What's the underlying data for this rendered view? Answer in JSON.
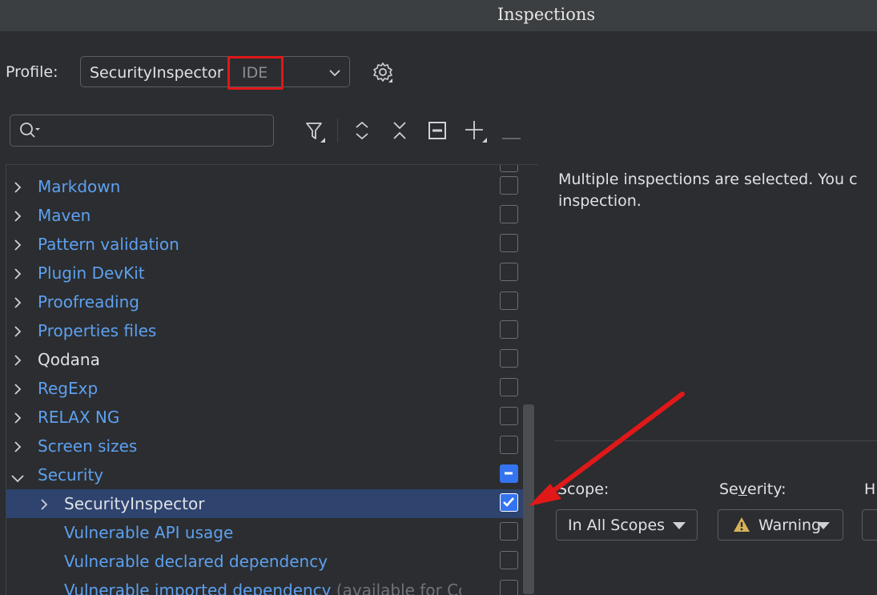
{
  "window": {
    "title": "Inspections"
  },
  "profile": {
    "label": "Profile:",
    "name": "SecurityInspector",
    "scope": "IDE"
  },
  "search": {
    "placeholder": ""
  },
  "tree": {
    "rows": [
      {
        "label": "Markdown",
        "expanded": false,
        "checked": false
      },
      {
        "label": "Maven",
        "expanded": false,
        "checked": false
      },
      {
        "label": "Pattern validation",
        "expanded": false,
        "checked": false
      },
      {
        "label": "Plugin DevKit",
        "expanded": false,
        "checked": false
      },
      {
        "label": "Proofreading",
        "expanded": false,
        "checked": false
      },
      {
        "label": "Properties files",
        "expanded": false,
        "checked": false
      },
      {
        "label": "Qodana",
        "expanded": false,
        "checked": false
      },
      {
        "label": "RegExp",
        "expanded": false,
        "checked": false
      },
      {
        "label": "RELAX NG",
        "expanded": false,
        "checked": false
      },
      {
        "label": "Screen sizes",
        "expanded": false,
        "checked": false
      },
      {
        "label": "Security",
        "expanded": true,
        "checked": "partial"
      },
      {
        "label": "SecurityInspector",
        "expanded": false,
        "checked": true,
        "selected": true
      },
      {
        "label": "Vulnerable API usage",
        "checked": false
      },
      {
        "label": "Vulnerable declared dependency",
        "checked": false
      },
      {
        "label": "Vulnerable imported dependency",
        "suffix": "(available for Cc",
        "checked": false
      }
    ]
  },
  "details": {
    "description_line1": "Multiple inspections are selected. You c",
    "description_line2": "inspection.",
    "scope_label": "Scope:",
    "severity_label": "Severity:",
    "h_label": "H",
    "scope_value": "In All Scopes",
    "severity_value": "Warning"
  },
  "colors": {
    "accent": "#3574f0",
    "highlight": "#e01818",
    "link": "#5ea0ef"
  }
}
